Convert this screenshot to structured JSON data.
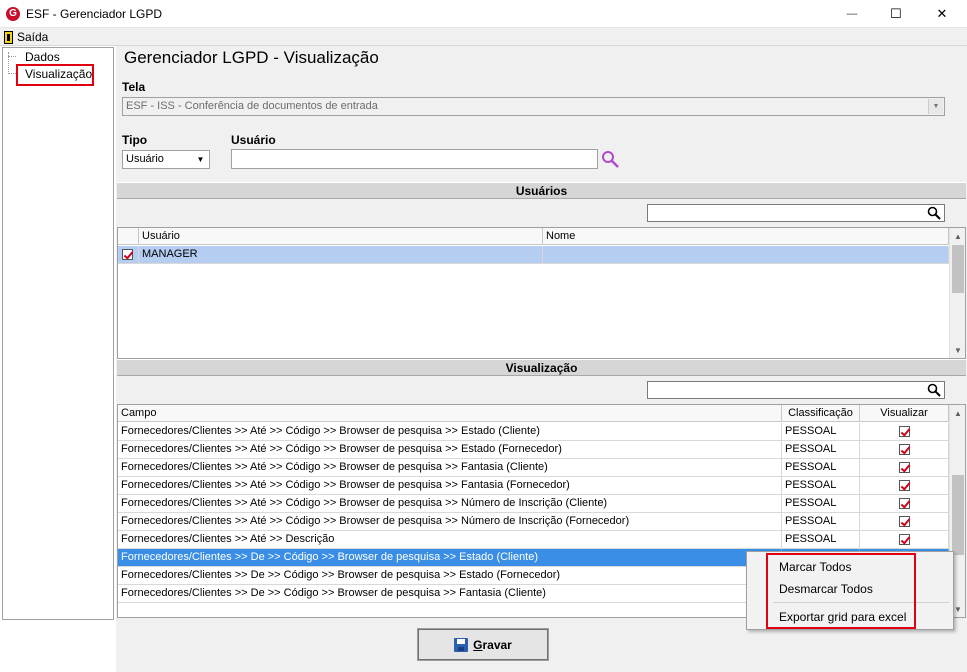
{
  "window": {
    "title": "ESF - Gerenciador LGPD",
    "logo": "G",
    "minimize_glyph": "—",
    "maximize_glyph": "☐",
    "close_glyph": "✕"
  },
  "menu": {
    "exit_label": "Saída"
  },
  "tree": {
    "items": [
      {
        "label": "Dados"
      },
      {
        "label": "Visualização"
      }
    ]
  },
  "page": {
    "title": "Gerenciador LGPD - Visualização"
  },
  "tela": {
    "label": "Tela",
    "value": "ESF - ISS - Conferência de documentos de entrada"
  },
  "tipo": {
    "label": "Tipo",
    "value": "Usuário"
  },
  "usuario": {
    "label": "Usuário",
    "value": ""
  },
  "users_section": {
    "title": "Usuários",
    "search_value": "",
    "columns": [
      "Usuário",
      "Nome"
    ],
    "rows": [
      {
        "checked": true,
        "usuario": "MANAGER",
        "nome": ""
      }
    ]
  },
  "view_section": {
    "title": "Visualização",
    "search_value": "",
    "columns": [
      "Campo",
      "Classificação",
      "Visualizar"
    ],
    "rows": [
      {
        "campo": "Fornecedores/Clientes >> Até >> Código >> Browser de pesquisa >> Estado (Cliente)",
        "classificacao": "PESSOAL",
        "visualizar": true
      },
      {
        "campo": "Fornecedores/Clientes >> Até >> Código >> Browser de pesquisa >> Estado (Fornecedor)",
        "classificacao": "PESSOAL",
        "visualizar": true
      },
      {
        "campo": "Fornecedores/Clientes >> Até >> Código >> Browser de pesquisa >> Fantasia (Cliente)",
        "classificacao": "PESSOAL",
        "visualizar": true
      },
      {
        "campo": "Fornecedores/Clientes >> Até >> Código >> Browser de pesquisa >> Fantasia (Fornecedor)",
        "classificacao": "PESSOAL",
        "visualizar": true
      },
      {
        "campo": "Fornecedores/Clientes >> Até >> Código >> Browser de pesquisa >> Número de Inscrição (Cliente)",
        "classificacao": "PESSOAL",
        "visualizar": true
      },
      {
        "campo": "Fornecedores/Clientes >> Até >> Código >> Browser de pesquisa >> Número de Inscrição (Fornecedor)",
        "classificacao": "PESSOAL",
        "visualizar": true
      },
      {
        "campo": "Fornecedores/Clientes >> Até >> Descrição",
        "classificacao": "PESSOAL",
        "visualizar": true
      },
      {
        "campo": "Fornecedores/Clientes >> De >> Código >> Browser de pesquisa >> Estado (Cliente)",
        "classificacao": "",
        "visualizar": null,
        "selected": true
      },
      {
        "campo": "Fornecedores/Clientes >> De >> Código >> Browser de pesquisa >> Estado (Fornecedor)",
        "classificacao": "",
        "visualizar": null
      },
      {
        "campo": "Fornecedores/Clientes >> De >> Código >> Browser de pesquisa >> Fantasia (Cliente)",
        "classificacao": "",
        "visualizar": null
      }
    ]
  },
  "context_menu": {
    "items": [
      "Marcar Todos",
      "Desmarcar Todos",
      "Exportar grid para excel"
    ]
  },
  "save_button": {
    "label": "Gravar"
  },
  "colors": {
    "highlight": "#e0000f",
    "selection": "#3a8ee6",
    "check": "#d0021b",
    "search_icon": "#b04cc8"
  }
}
